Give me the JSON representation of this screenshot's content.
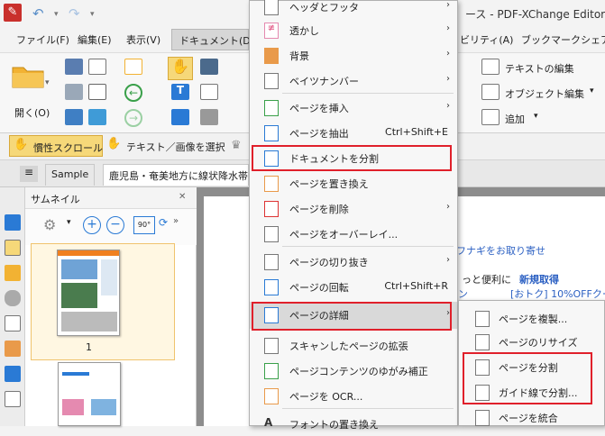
{
  "window": {
    "title": "ース - PDF-XChange Editor"
  },
  "menubar": {
    "items": [
      "ファイル(F)",
      "編集(E)",
      "表示(V)",
      "ドキュメント(D)",
      "ビリティ(A)",
      "ブックマーク",
      "シェア"
    ]
  },
  "ribbon": {
    "open_label": "開く(O)",
    "right_items": [
      "テキストの編集",
      "オブジェクト編集",
      "追加"
    ]
  },
  "toolbar2": {
    "inertial_scroll": "慣性スクロール",
    "select_text": "テキスト／画像を選択"
  },
  "tabs": {
    "sample": "Sample",
    "doc": "鹿児島・奄美地方に線状降水帯"
  },
  "thumbnails": {
    "title": "サムネイル",
    "rotate_label": "90°",
    "page1_label": "1"
  },
  "document": {
    "lines": [
      "フナギをお取り寄せ",
      "っと便利に",
      "新規取得",
      "ン",
      "[おトク] 10%OFFクーオ"
    ]
  },
  "context_menu": {
    "items": [
      {
        "label": "ヘッダとフッタ",
        "arrow": true
      },
      {
        "label": "透かし",
        "arrow": true
      },
      {
        "label": "背景",
        "arrow": true
      },
      {
        "label": "ベイツナンバー",
        "arrow": true
      },
      {
        "label": "ページを挿入",
        "arrow": true
      },
      {
        "label": "ページを抽出",
        "shortcut": "Ctrl+Shift+E"
      },
      {
        "label": "ドキュメントを分割"
      },
      {
        "label": "ページを置き換え"
      },
      {
        "label": "ページを削除",
        "arrow": true
      },
      {
        "label": "ページをオーバーレイ..."
      },
      {
        "label": "ページの切り抜き",
        "arrow": true
      },
      {
        "label": "ページの回転",
        "shortcut": "Ctrl+Shift+R"
      },
      {
        "label": "ページの詳細",
        "arrow": true
      },
      {
        "label": "スキャンしたページの拡張"
      },
      {
        "label": "ページコンテンツのゆがみ補正"
      },
      {
        "label": "ページを OCR..."
      },
      {
        "label": "フォントの置き換え"
      }
    ]
  },
  "submenu": {
    "items": [
      "ページを複製...",
      "ページのリサイズ",
      "ページを分割",
      "ガイド線で分割...",
      "ページを統合"
    ]
  },
  "colors": {
    "highlight": "#e0202b",
    "accent": "#2a7ad5"
  }
}
